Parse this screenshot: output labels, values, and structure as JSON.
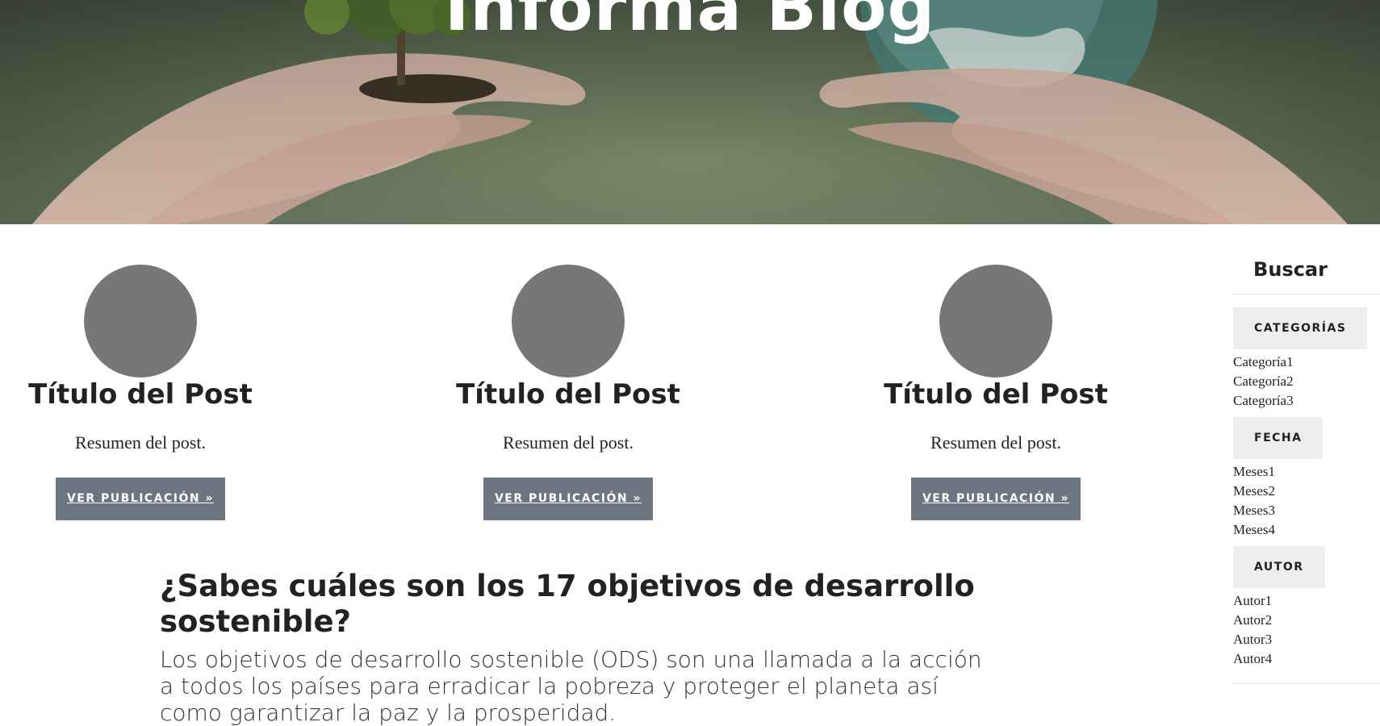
{
  "hero": {
    "title": "Informa Blog"
  },
  "posts": [
    {
      "title": "Título del Post",
      "summary": "Resumen del post.",
      "button": "VER PUBLICACIÓN »"
    },
    {
      "title": "Título del Post",
      "summary": "Resumen del post.",
      "button": "VER PUBLICACIÓN »"
    },
    {
      "title": "Título del Post",
      "summary": "Resumen del post.",
      "button": "VER PUBLICACIÓN »"
    }
  ],
  "article": {
    "heading": "¿Sabes cuáles son los 17 objetivos de desarrollo sostenible?",
    "body": "Los objetivos de desarrollo sostenible (ODS) son una llamada a la acción a todos los países para erradicar la pobreza y proteger el planeta así como garantizar la paz y la prosperidad."
  },
  "sidebar": {
    "search": "Buscar",
    "sections": [
      {
        "label": "CATEGORÍAS",
        "items": [
          "Categoría1",
          "Categoría2",
          "Categoría3"
        ]
      },
      {
        "label": "FECHA",
        "items": [
          "Meses1",
          "Meses2",
          "Meses3",
          "Meses4"
        ]
      },
      {
        "label": "AUTOR",
        "items": [
          "Autor1",
          "Autor2",
          "Autor3",
          "Autor4"
        ]
      }
    ]
  },
  "colors": {
    "button_bg": "#6c7680",
    "thumb": "#777777",
    "sidebar_label_bg": "#eeeeee"
  }
}
